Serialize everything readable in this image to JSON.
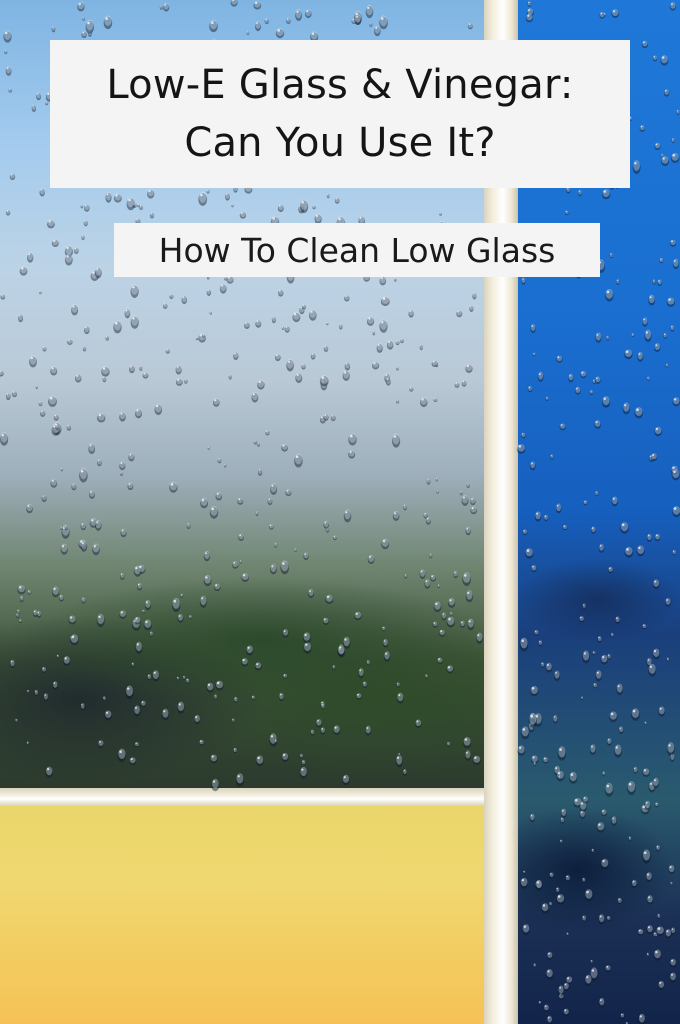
{
  "title": {
    "line1": "Low-E Glass & Vinegar:",
    "line2": "Can You Use It?"
  },
  "subtitle": "How To Clean Low Glass",
  "colors": {
    "sky_top": "#7fb4e2",
    "right_pane_blue": "#1f78d8",
    "frame": "#f3eedc",
    "bottom_panel_yellow": "#f0d870",
    "text_box": "#f4f4f4",
    "text": "#151515"
  },
  "image_elements": [
    "rain-drops",
    "window-frame",
    "blurred-trees"
  ]
}
